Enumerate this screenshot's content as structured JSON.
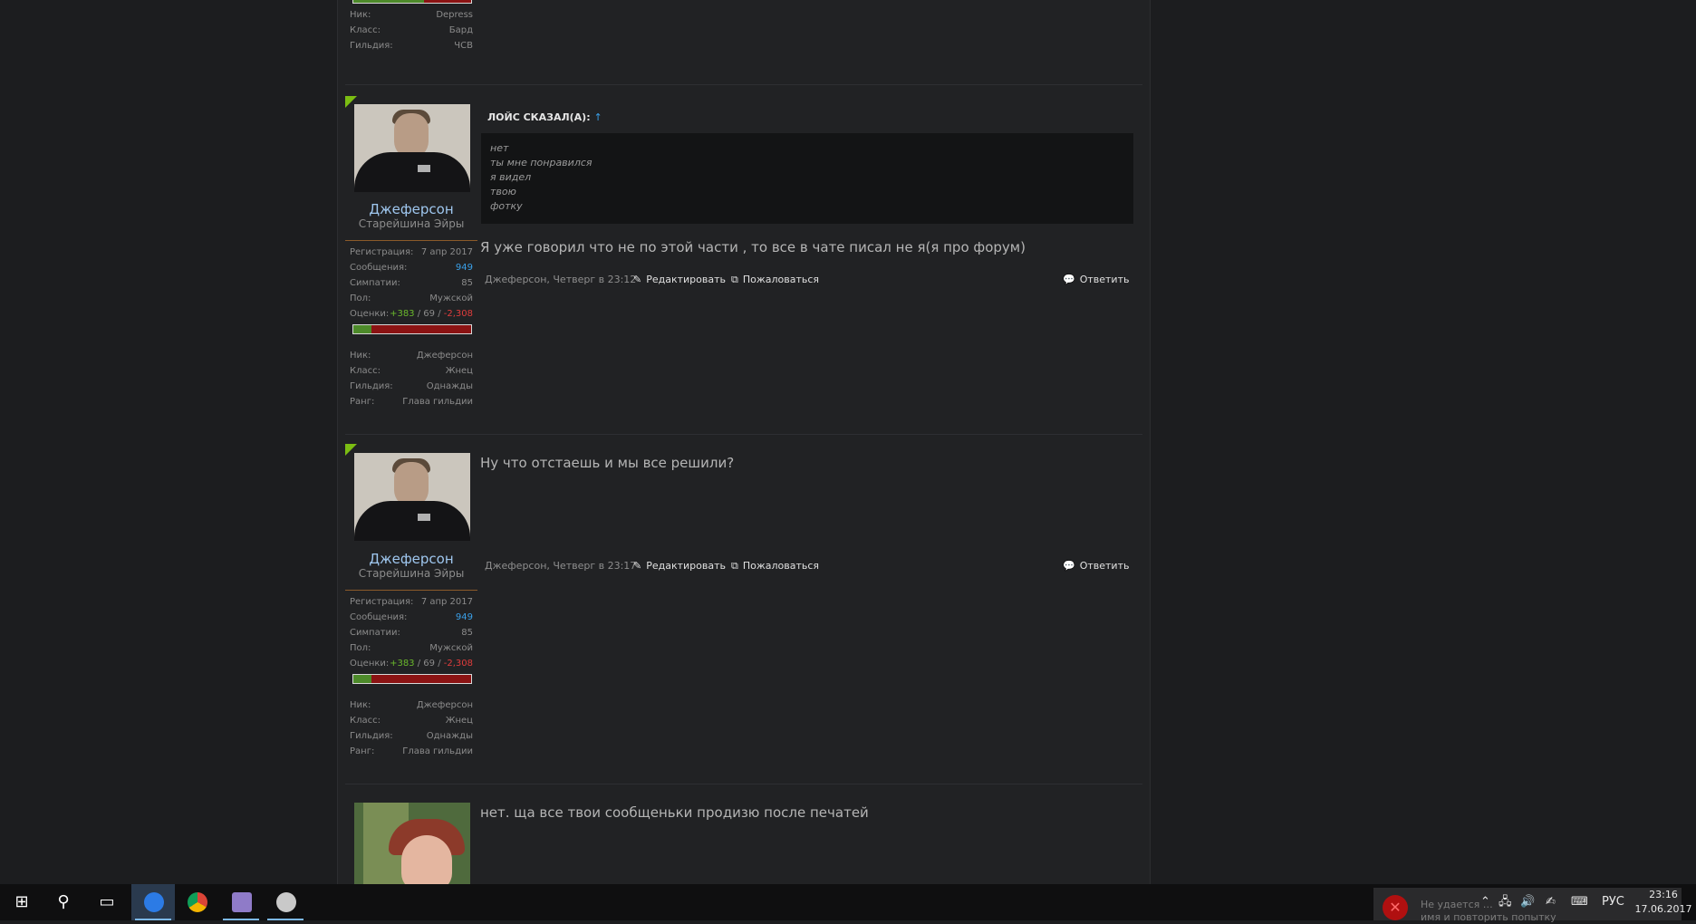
{
  "labels": {
    "registration": "Регистрация:",
    "messages": "Сообщения:",
    "likes": "Симпатии:",
    "gender": "Пол:",
    "ratings": "Оценки:",
    "nick": "Ник:",
    "class": "Класс:",
    "guild": "Гильдия:",
    "rank": "Ранг:",
    "edit": "Редактировать",
    "report": "Пожаловаться",
    "reply": "Ответить",
    "rating_sep": " / "
  },
  "prev_post": {
    "nick": "Depress",
    "class": "Бард",
    "guild": "ЧСВ"
  },
  "post1": {
    "username": "Джеферсон",
    "user_title": "Старейшина Эйры",
    "registration": "7 апр 2017",
    "messages": "949",
    "likes": "85",
    "gender": "Мужской",
    "rating_pos": "+383",
    "rating_neutral": "69",
    "rating_neg": "-2,308",
    "rating_fill": 0.15,
    "nick": "Джеферсон",
    "class": "Жнец",
    "guild": "Однажды",
    "rank": "Глава гильдии",
    "quote_author": "ЛОЙС СКАЗАЛ(А):",
    "quote_arrow": "↑",
    "quote_lines": [
      "нет",
      "ты мне понравился",
      "я видел",
      "твою",
      "фотку"
    ],
    "message": "Я уже говорил что не по этой части , то все в чате писал не я(я про форум)",
    "meta": "Джеферсон, Четверг в 23:12"
  },
  "post2": {
    "username": "Джеферсон",
    "user_title": "Старейшина Эйры",
    "registration": "7 апр 2017",
    "messages": "949",
    "likes": "85",
    "gender": "Мужской",
    "rating_pos": "+383",
    "rating_neutral": "69",
    "rating_neg": "-2,308",
    "rating_fill": 0.15,
    "nick": "Джеферсон",
    "class": "Жнец",
    "guild": "Однажды",
    "rank": "Глава гильдии",
    "message": "Ну что отстаешь и мы все решили?",
    "meta": "Джеферсон, Четверг в 23:17"
  },
  "post3": {
    "message": "нет. ща все твои сообщеньки продизю после печатей"
  },
  "taskbar": {
    "toast_line1": "Не удается …",
    "toast_line2": "имя и повторить попытку",
    "lang": "РУС",
    "time": "23:16",
    "date": "17.06.2017"
  },
  "colors": {
    "accent_blue": "#3aa0e8",
    "username": "#9fc7ef",
    "positive": "#6ab82c",
    "negative": "#e03c3c",
    "new_marker": "#7bbd12"
  }
}
